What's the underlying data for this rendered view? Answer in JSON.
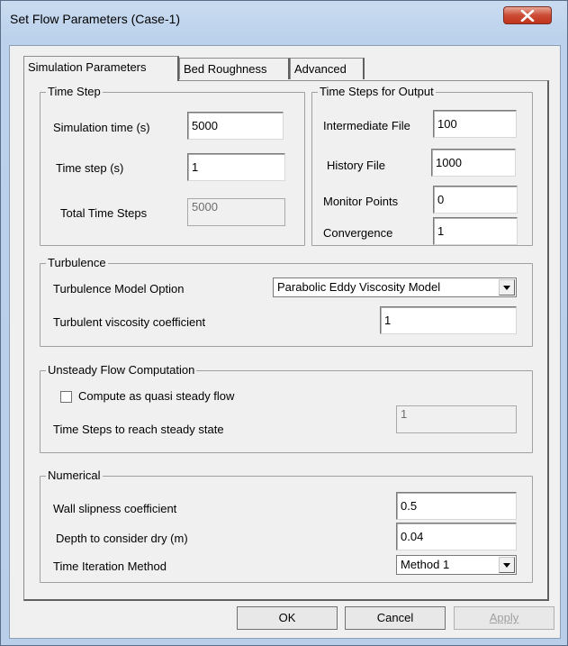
{
  "window": {
    "title": "Set Flow Parameters (Case-1)"
  },
  "tabs": [
    {
      "label": "Simulation Parameters",
      "active": true
    },
    {
      "label": "Bed Roughness",
      "active": false
    },
    {
      "label": "Advanced",
      "active": false
    }
  ],
  "time_step": {
    "title": "Time Step",
    "simulation_time_label": "Simulation time (s)",
    "simulation_time_value": "5000",
    "time_step_label": "Time step (s)",
    "time_step_value": "1",
    "total_steps_label": "Total Time Steps",
    "total_steps_value": "5000"
  },
  "output": {
    "title": "Time Steps for Output",
    "intermediate_label": "Intermediate File",
    "intermediate_value": "100",
    "history_label": "History File",
    "history_value": "1000",
    "monitor_label": "Monitor Points",
    "monitor_value": "0",
    "convergence_label": "Convergence",
    "convergence_value": "1"
  },
  "turbulence": {
    "title": "Turbulence",
    "model_label": "Turbulence Model Option",
    "model_value": "Parabolic Eddy Viscosity Model",
    "coef_label": "Turbulent viscosity coefficient",
    "coef_value": "1"
  },
  "unsteady": {
    "title": "Unsteady Flow Computation",
    "checkbox_label": "Compute as quasi steady flow",
    "checked": false,
    "steady_label": "Time Steps to reach steady state",
    "steady_value": "1"
  },
  "numerical": {
    "title": "Numerical",
    "wall_label": "Wall slipness coefficient",
    "wall_value": "0.5",
    "depth_label": "Depth to consider dry (m)",
    "depth_value": "0.04",
    "method_label": "Time Iteration Method",
    "method_value": "Method 1"
  },
  "buttons": {
    "ok": "OK",
    "cancel": "Cancel",
    "apply": "Apply"
  }
}
